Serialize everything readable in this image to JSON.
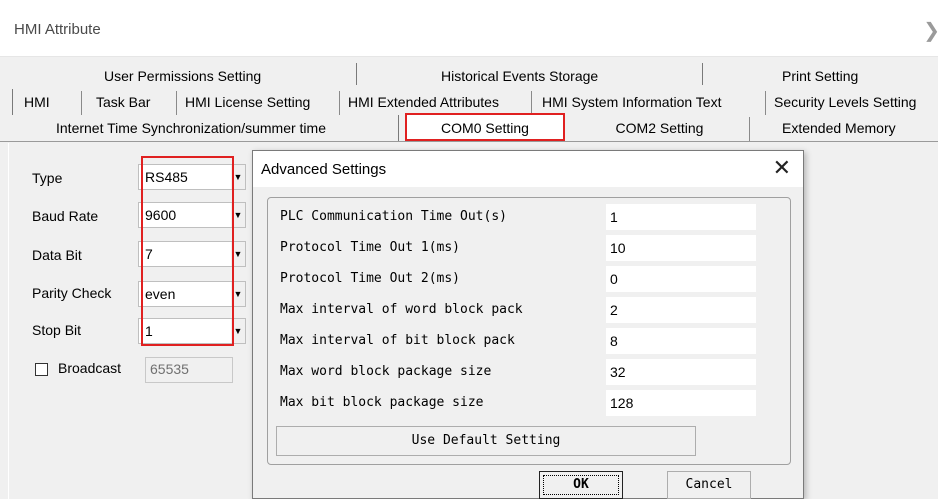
{
  "window": {
    "title": "HMI Attribute"
  },
  "tabs": {
    "row1": [
      "User Permissions Setting",
      "Historical Events Storage",
      "Print Setting"
    ],
    "row2": [
      "HMI",
      "Task Bar",
      "HMI License Setting",
      "HMI Extended Attributes",
      "HMI System Information Text",
      "Security Levels Setting"
    ],
    "row3": [
      "Internet Time Synchronization/summer time",
      "COM0 Setting",
      "COM2 Setting",
      "Extended Memory"
    ],
    "active": "COM0 Setting"
  },
  "com0": {
    "type_label": "Type",
    "type_value": "RS485",
    "baud_label": "Baud Rate",
    "baud_value": "9600",
    "databit_label": "Data Bit",
    "databit_value": "7",
    "parity_label": "Parity Check",
    "parity_value": "even",
    "stopbit_label": "Stop Bit",
    "stopbit_value": "1",
    "broadcast_label": "Broadcast",
    "broadcast_checked": false,
    "broadcast_value": "65535"
  },
  "dialog": {
    "title": "Advanced Settings",
    "params": [
      {
        "label": "PLC Communication Time Out(s)",
        "value": "1"
      },
      {
        "label": "Protocol Time Out 1(ms)",
        "value": "10"
      },
      {
        "label": "Protocol Time Out 2(ms)",
        "value": "0"
      },
      {
        "label": "Max interval of word block pack",
        "value": "2"
      },
      {
        "label": "Max interval of bit block pack",
        "value": "8"
      },
      {
        "label": "Max word block package size",
        "value": "32"
      },
      {
        "label": "Max bit block package size",
        "value": "128"
      }
    ],
    "default_button": "Use Default Setting",
    "ok_button": "OK",
    "cancel_button": "Cancel"
  },
  "colors": {
    "highlight": "#e02020",
    "background": "#f0f0f0"
  }
}
